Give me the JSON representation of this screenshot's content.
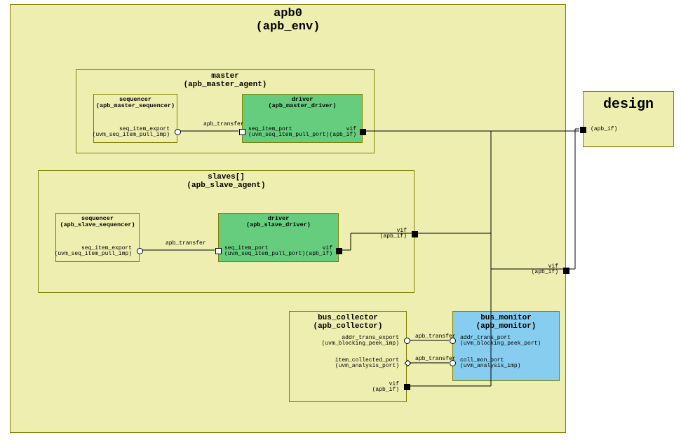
{
  "env": {
    "label_line1": "apb0",
    "label_line2": "(apb_env)"
  },
  "design": {
    "label": "design",
    "port_vif_name": "(apb_if)"
  },
  "master_agent": {
    "label_line1": "master",
    "label_line2": "(apb_master_agent)",
    "sequencer": {
      "label_line1": "sequencer",
      "label_line2": "(apb_master_sequencer)",
      "port_name": "seq_item_export",
      "port_type": "(uvm_seq_item_pull_imp)"
    },
    "driver": {
      "label_line1": "driver",
      "label_line2": "(apb_master_driver)",
      "port_left_name": "seq_item_port",
      "port_left_type": "(uvm_seq_item_pull_port)",
      "port_right_name": "vif",
      "port_right_type": "(apb_if)"
    },
    "conn_label": "apb_transfer"
  },
  "slave_agent": {
    "label_line1": "slaves[]",
    "label_line2": "(apb_slave_agent)",
    "sequencer": {
      "label_line1": "sequencer",
      "label_line2": "(apb_slave_sequencer)",
      "port_name": "seq_item_export",
      "port_type": "(uvm_seq_item_pull_imp)"
    },
    "driver": {
      "label_line1": "driver",
      "label_line2": "(apb_slave_driver)",
      "port_left_name": "seq_item_port",
      "port_left_type": "(uvm_seq_item_pull_port)",
      "port_right_name": "vif",
      "port_right_type": "(apb_if)"
    },
    "agent_port_name": "vif",
    "agent_port_type": "(apb_if)",
    "conn_label": "apb_transfer"
  },
  "env_port": {
    "name": "vif",
    "type": "(apb_if)"
  },
  "bus_collector": {
    "label_line1": "bus_collector",
    "label_line2": "(apb_collector)",
    "port1_name": "addr_trans_export",
    "port1_type": "(uvm_blocking_peek_imp)",
    "port2_name": "item_collected_port",
    "port2_type": "(uvm_analysis_port)",
    "port3_name": "vif",
    "port3_type": "(apb_if)"
  },
  "bus_monitor": {
    "label_line1": "bus_monitor",
    "label_line2": "(apb_monitor)",
    "port1_name": "addr_trans_port",
    "port1_type": "(uvm_blocking_peek_port)",
    "port2_name": "coll_mon_port",
    "port2_type": "(uvm_analysis_imp)"
  },
  "conn_labels": {
    "coll_mon1": "apb_transfer",
    "coll_mon2": "apb_transfer"
  }
}
